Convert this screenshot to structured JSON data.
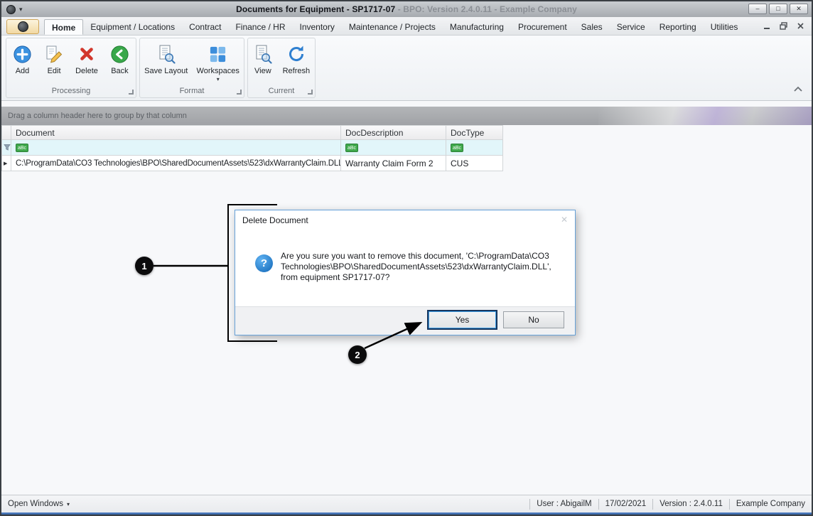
{
  "titlebar": {
    "title_main": "Documents for Equipment - SP1717-07",
    "title_suffix": " - BPO: Version 2.4.0.11 - Example Company"
  },
  "menu": {
    "tabs": [
      {
        "label": "Home"
      },
      {
        "label": "Equipment / Locations"
      },
      {
        "label": "Contract"
      },
      {
        "label": "Finance / HR"
      },
      {
        "label": "Inventory"
      },
      {
        "label": "Maintenance / Projects"
      },
      {
        "label": "Manufacturing"
      },
      {
        "label": "Procurement"
      },
      {
        "label": "Sales"
      },
      {
        "label": "Service"
      },
      {
        "label": "Reporting"
      },
      {
        "label": "Utilities"
      }
    ]
  },
  "ribbon": {
    "groups": [
      {
        "name": "Processing",
        "buttons": [
          {
            "label": "Add"
          },
          {
            "label": "Edit"
          },
          {
            "label": "Delete"
          },
          {
            "label": "Back"
          }
        ]
      },
      {
        "name": "Format",
        "buttons": [
          {
            "label": "Save Layout"
          },
          {
            "label": "Workspaces"
          }
        ]
      },
      {
        "name": "Current",
        "buttons": [
          {
            "label": "View"
          },
          {
            "label": "Refresh"
          }
        ]
      }
    ]
  },
  "grid": {
    "group_by_hint": "Drag a column header here to group by that column",
    "columns": [
      {
        "label": "Document"
      },
      {
        "label": "DocDescription"
      },
      {
        "label": "DocType"
      }
    ],
    "rows": [
      {
        "document": "C:\\ProgramData\\CO3 Technologies\\BPO\\SharedDocumentAssets\\523\\dxWarrantyClaim.DLL",
        "doc_description": "Warranty Claim Form 2",
        "doc_type": "CUS"
      }
    ]
  },
  "dialog": {
    "title": "Delete Document",
    "message": "Are you sure you want to remove this document, 'C:\\ProgramData\\CO3 Technologies\\BPO\\SharedDocumentAssets\\523\\dxWarrantyClaim.DLL', from equipment SP1717-07?",
    "buttons": {
      "yes": "Yes",
      "no": "No"
    }
  },
  "callouts": {
    "one": "1",
    "two": "2"
  },
  "statusbar": {
    "open_windows": "Open Windows",
    "user": "User : AbigailM",
    "date": "17/02/2021",
    "version": "Version : 2.4.0.11",
    "company": "Example Company"
  },
  "icons": {
    "caret_down": "▾",
    "close": "✕",
    "minimize": "–",
    "maximize": "□",
    "row_indicator": "▶",
    "question_mark": "?",
    "abc": "aBc"
  },
  "colors": {
    "accent_blue": "#3b92e0",
    "delete_red": "#d2372c",
    "back_green": "#39a84a",
    "filter_row_bg": "#e2f6fa",
    "yes_highlight": "#16365e"
  }
}
